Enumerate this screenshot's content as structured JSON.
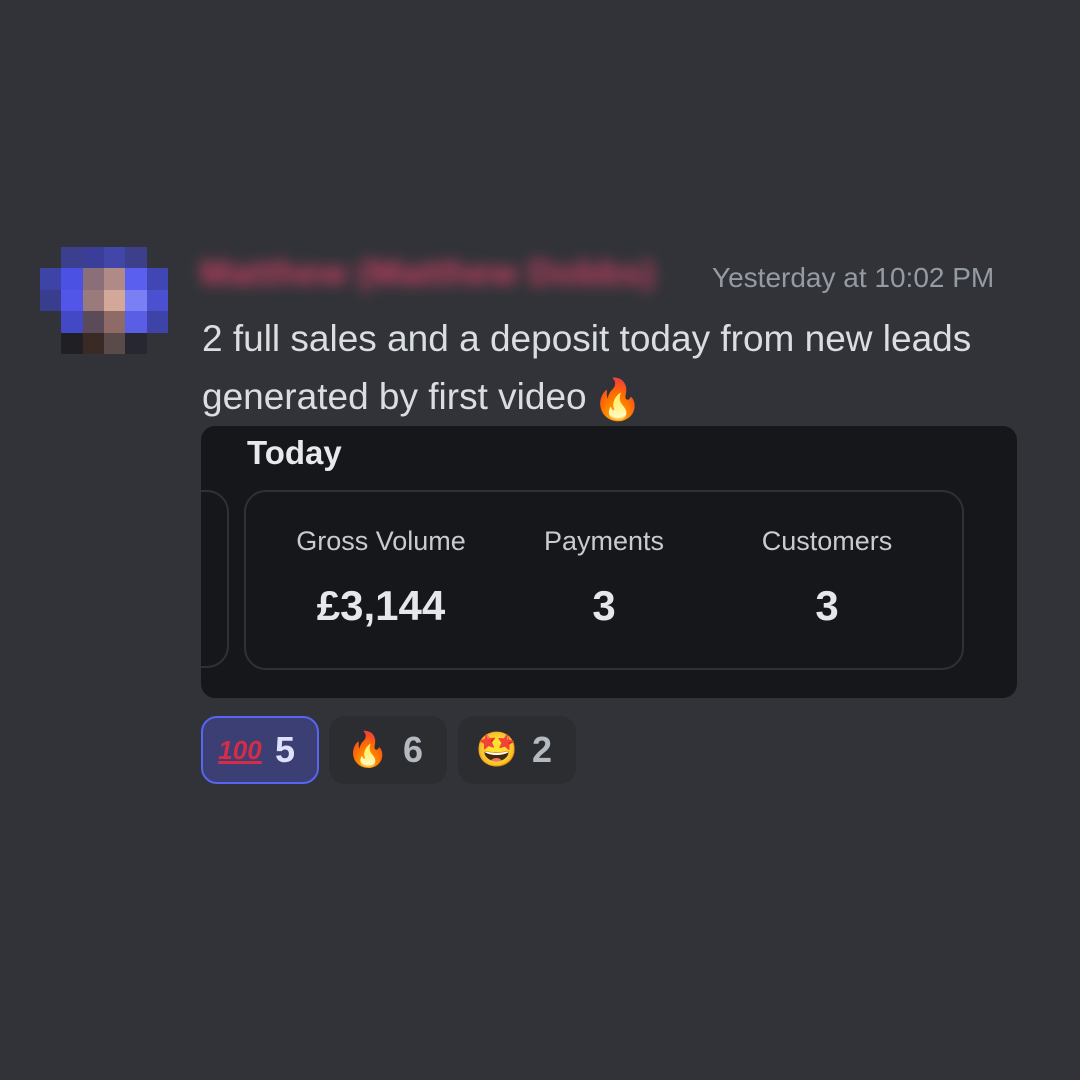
{
  "message": {
    "author": "Matthew (Matthew Dobbs)",
    "timestamp": "Yesterday at 10:02 PM",
    "text": "2 full sales and a deposit today from new leads generated by first video",
    "text_emoji": "🔥",
    "text_emoji_name": "fire-emoji"
  },
  "attachment": {
    "heading": "Today",
    "stats": [
      {
        "label": "Gross Volume",
        "value": "£3,144"
      },
      {
        "label": "Payments",
        "value": "3"
      },
      {
        "label": "Customers",
        "value": "3"
      }
    ]
  },
  "reactions": [
    {
      "emoji": "💯",
      "emoji_name": "hundred-points-emoji",
      "count": "5",
      "active": true
    },
    {
      "emoji": "🔥",
      "emoji_name": "fire-emoji",
      "count": "6",
      "active": false
    },
    {
      "emoji": "🤩",
      "emoji_name": "star-struck-emoji",
      "count": "2",
      "active": false
    }
  ],
  "colors": {
    "background": "#313338",
    "author_name": "#e0436b",
    "timestamp": "#949ba4",
    "attachment_bg": "#16171b",
    "reaction_active_border": "#5865f2",
    "reaction_active_bg": "#3b3f73"
  }
}
